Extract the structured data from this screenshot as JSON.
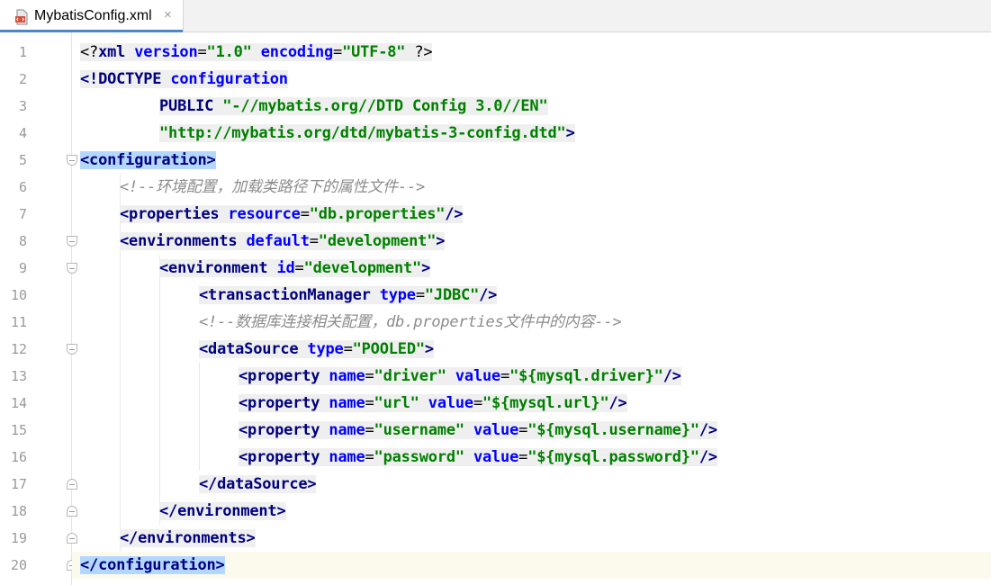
{
  "tab": {
    "title": "MybatisConfig.xml",
    "close_icon": "×",
    "file_icon": "xml-file-icon"
  },
  "colors": {
    "tag": "#000080",
    "attr": "#0000ff",
    "value": "#008000",
    "comment": "#8c8c8c",
    "selection": "#b3d7ff",
    "current_line": "#fcfaed"
  },
  "lines": [
    {
      "n": "1",
      "fold": "",
      "indent": 0,
      "tokens": [
        {
          "t": "<?",
          "c": "punc"
        },
        {
          "t": "xml",
          "c": "tag"
        },
        {
          "t": " ",
          "c": "punc"
        },
        {
          "t": "version",
          "c": "attr"
        },
        {
          "t": "=",
          "c": "punc"
        },
        {
          "t": "\"1.0\"",
          "c": "val"
        },
        {
          "t": " ",
          "c": "punc"
        },
        {
          "t": "encoding",
          "c": "attr"
        },
        {
          "t": "=",
          "c": "punc"
        },
        {
          "t": "\"UTF-8\"",
          "c": "val"
        },
        {
          "t": " ",
          "c": "punc"
        },
        {
          "t": "?>",
          "c": "punc"
        }
      ]
    },
    {
      "n": "2",
      "fold": "",
      "indent": 0,
      "tokens": [
        {
          "t": "<!DOCTYPE ",
          "c": "tag"
        },
        {
          "t": "configuration",
          "c": "attr"
        }
      ]
    },
    {
      "n": "3",
      "fold": "",
      "indent": 8,
      "tokens": [
        {
          "t": "PUBLIC ",
          "c": "pub"
        },
        {
          "t": "\"-//mybatis.org//DTD Config 3.0//EN\"",
          "c": "val"
        }
      ]
    },
    {
      "n": "4",
      "fold": "",
      "indent": 8,
      "tokens": [
        {
          "t": "\"http://mybatis.org/dtd/mybatis-3-config.dtd\"",
          "c": "val"
        },
        {
          "t": ">",
          "c": "tag"
        }
      ]
    },
    {
      "n": "5",
      "fold": "open",
      "indent": 0,
      "hl": true,
      "tokens": [
        {
          "t": "<configuration>",
          "c": "tag"
        }
      ]
    },
    {
      "n": "6",
      "fold": "",
      "indent": 4,
      "nobg": true,
      "tokens": [
        {
          "t": "<!--环境配置，加载类路径下的属性文件-->",
          "c": "com"
        }
      ]
    },
    {
      "n": "7",
      "fold": "",
      "indent": 4,
      "tokens": [
        {
          "t": "<properties ",
          "c": "tag"
        },
        {
          "t": "resource",
          "c": "attr"
        },
        {
          "t": "=",
          "c": "punc"
        },
        {
          "t": "\"db.properties\"",
          "c": "val"
        },
        {
          "t": "/>",
          "c": "tag"
        }
      ]
    },
    {
      "n": "8",
      "fold": "open",
      "indent": 4,
      "tokens": [
        {
          "t": "<environments ",
          "c": "tag"
        },
        {
          "t": "default",
          "c": "attr"
        },
        {
          "t": "=",
          "c": "punc"
        },
        {
          "t": "\"development\"",
          "c": "val"
        },
        {
          "t": ">",
          "c": "tag"
        }
      ]
    },
    {
      "n": "9",
      "fold": "open",
      "indent": 8,
      "tokens": [
        {
          "t": "<environment ",
          "c": "tag"
        },
        {
          "t": "id",
          "c": "attr"
        },
        {
          "t": "=",
          "c": "punc"
        },
        {
          "t": "\"development\"",
          "c": "val"
        },
        {
          "t": ">",
          "c": "tag"
        }
      ]
    },
    {
      "n": "10",
      "fold": "",
      "indent": 12,
      "tokens": [
        {
          "t": "<transactionManager ",
          "c": "tag"
        },
        {
          "t": "type",
          "c": "attr"
        },
        {
          "t": "=",
          "c": "punc"
        },
        {
          "t": "\"JDBC\"",
          "c": "val"
        },
        {
          "t": "/>",
          "c": "tag"
        }
      ]
    },
    {
      "n": "11",
      "fold": "",
      "indent": 12,
      "nobg": true,
      "tokens": [
        {
          "t": "<!--数据库连接相关配置，db.properties文件中的内容-->",
          "c": "com"
        }
      ]
    },
    {
      "n": "12",
      "fold": "open",
      "indent": 12,
      "tokens": [
        {
          "t": "<dataSource ",
          "c": "tag"
        },
        {
          "t": "type",
          "c": "attr"
        },
        {
          "t": "=",
          "c": "punc"
        },
        {
          "t": "\"POOLED\"",
          "c": "val"
        },
        {
          "t": ">",
          "c": "tag"
        }
      ]
    },
    {
      "n": "13",
      "fold": "",
      "indent": 16,
      "tokens": [
        {
          "t": "<property ",
          "c": "tag"
        },
        {
          "t": "name",
          "c": "attr"
        },
        {
          "t": "=",
          "c": "punc"
        },
        {
          "t": "\"driver\"",
          "c": "val"
        },
        {
          "t": " ",
          "c": "punc"
        },
        {
          "t": "value",
          "c": "attr"
        },
        {
          "t": "=",
          "c": "punc"
        },
        {
          "t": "\"${mysql.driver}\"",
          "c": "val"
        },
        {
          "t": "/>",
          "c": "tag"
        }
      ]
    },
    {
      "n": "14",
      "fold": "",
      "indent": 16,
      "tokens": [
        {
          "t": "<property ",
          "c": "tag"
        },
        {
          "t": "name",
          "c": "attr"
        },
        {
          "t": "=",
          "c": "punc"
        },
        {
          "t": "\"url\"",
          "c": "val"
        },
        {
          "t": " ",
          "c": "punc"
        },
        {
          "t": "value",
          "c": "attr"
        },
        {
          "t": "=",
          "c": "punc"
        },
        {
          "t": "\"${mysql.url}\"",
          "c": "val"
        },
        {
          "t": "/>",
          "c": "tag"
        }
      ]
    },
    {
      "n": "15",
      "fold": "",
      "indent": 16,
      "tokens": [
        {
          "t": "<property ",
          "c": "tag"
        },
        {
          "t": "name",
          "c": "attr"
        },
        {
          "t": "=",
          "c": "punc"
        },
        {
          "t": "\"username\"",
          "c": "val"
        },
        {
          "t": " ",
          "c": "punc"
        },
        {
          "t": "value",
          "c": "attr"
        },
        {
          "t": "=",
          "c": "punc"
        },
        {
          "t": "\"${mysql.username}\"",
          "c": "val"
        },
        {
          "t": "/>",
          "c": "tag"
        }
      ]
    },
    {
      "n": "16",
      "fold": "",
      "indent": 16,
      "tokens": [
        {
          "t": "<property ",
          "c": "tag"
        },
        {
          "t": "name",
          "c": "attr"
        },
        {
          "t": "=",
          "c": "punc"
        },
        {
          "t": "\"password\"",
          "c": "val"
        },
        {
          "t": " ",
          "c": "punc"
        },
        {
          "t": "value",
          "c": "attr"
        },
        {
          "t": "=",
          "c": "punc"
        },
        {
          "t": "\"${mysql.password}\"",
          "c": "val"
        },
        {
          "t": "/>",
          "c": "tag"
        }
      ]
    },
    {
      "n": "17",
      "fold": "close",
      "indent": 12,
      "tokens": [
        {
          "t": "</dataSource>",
          "c": "tag"
        }
      ]
    },
    {
      "n": "18",
      "fold": "close",
      "indent": 8,
      "tokens": [
        {
          "t": "</environment>",
          "c": "tag"
        }
      ]
    },
    {
      "n": "19",
      "fold": "close",
      "indent": 4,
      "bulb": true,
      "tokens": [
        {
          "t": "</environments>",
          "c": "tag"
        }
      ]
    },
    {
      "n": "20",
      "fold": "close",
      "indent": 0,
      "hl": true,
      "current": true,
      "tokens": [
        {
          "t": "</configuration>",
          "c": "tag"
        }
      ]
    }
  ]
}
